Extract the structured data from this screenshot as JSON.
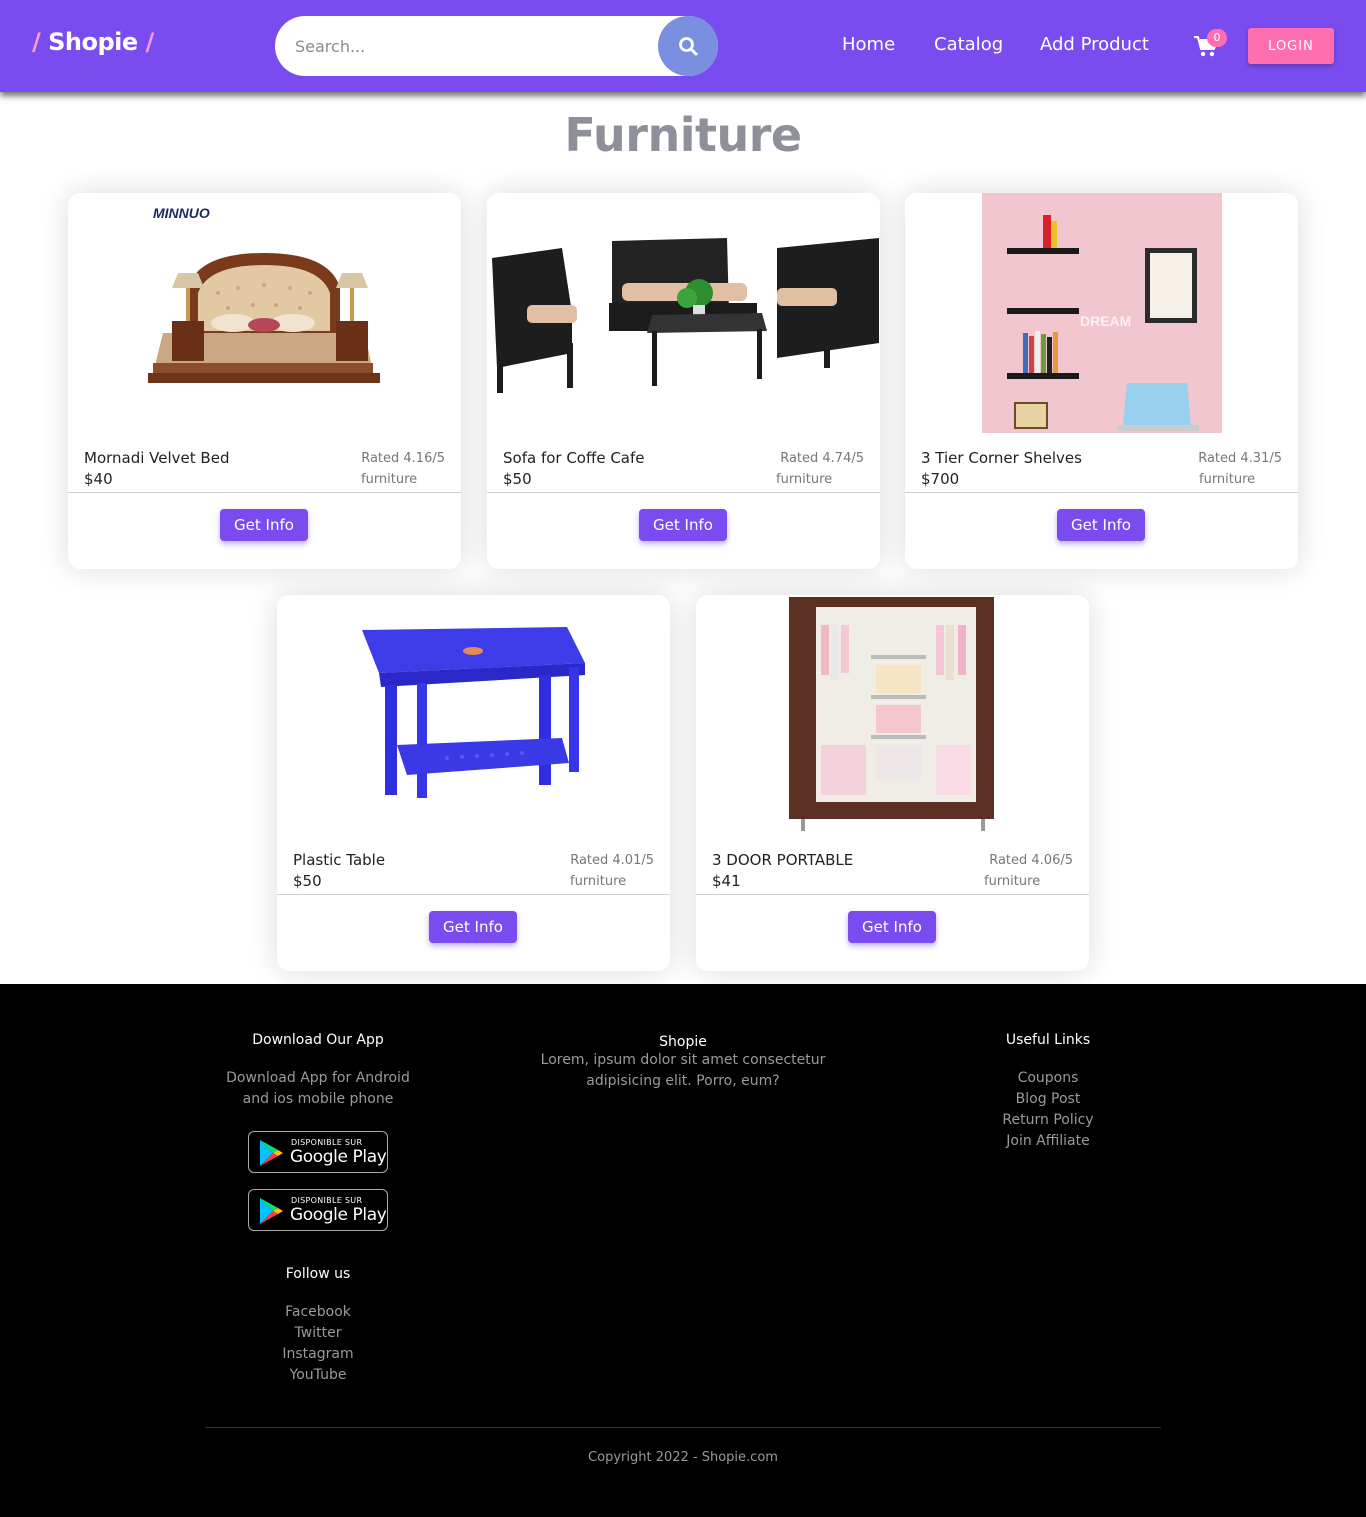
{
  "header": {
    "brand_slash_left": "/",
    "brand_name": "Shopie",
    "brand_slash_right": "/",
    "search_placeholder": "Search...",
    "nav": [
      "Home",
      "Catalog",
      "Add Product"
    ],
    "cart_count": "0",
    "login_label": "LOGIN"
  },
  "page": {
    "title": "Furniture"
  },
  "products": [
    {
      "name": "Mornadi Velvet Bed",
      "price": "$40",
      "rating": "Rated 4.16/5",
      "category": "furniture",
      "button": "Get Info",
      "image": "bed"
    },
    {
      "name": "Sofa for Coffe Cafe",
      "price": "$50",
      "rating": "Rated 4.74/5",
      "category": "furniture",
      "button": "Get Info",
      "image": "sofa-set"
    },
    {
      "name": "3 Tier Corner Shelves",
      "price": "$700",
      "rating": "Rated 4.31/5",
      "category": "furniture",
      "button": "Get Info",
      "image": "corner-shelves"
    },
    {
      "name": "Plastic Table",
      "price": "$50",
      "rating": "Rated 4.01/5",
      "category": "furniture",
      "button": "Get Info",
      "image": "plastic-table"
    },
    {
      "name": "3 DOOR PORTABLE",
      "price": "$41",
      "rating": "Rated 4.06/5",
      "category": "furniture",
      "button": "Get Info",
      "image": "wardrobe"
    }
  ],
  "images": {
    "bed_logo": "MINNUO",
    "shelves_watermark": "DREAM"
  },
  "footer": {
    "app": {
      "title": "Download Our App",
      "text_line1": "Download App for Android",
      "text_line2": "and ios mobile phone",
      "badge_small": "DISPONIBLE SUR",
      "badge_big": "Google Play"
    },
    "follow": {
      "title": "Follow us",
      "links": [
        "Facebook",
        "Twitter",
        "Instagram",
        "YouTube"
      ]
    },
    "about": {
      "title": "Shopie",
      "line1": "Lorem, ipsum dolor sit amet consectetur",
      "line2": "adipisicing elit. Porro, eum?"
    },
    "useful": {
      "title": "Useful Links",
      "links": [
        "Coupons",
        "Blog Post",
        "Return Policy",
        "Join Affiliate"
      ]
    },
    "copyright": "Copyright 2022 - Shopie.com"
  },
  "colors": {
    "primary": "#7a4cf0",
    "accent_pink": "#ff6fb0",
    "title_gray": "#8e9099",
    "footer_bg": "#000000"
  }
}
